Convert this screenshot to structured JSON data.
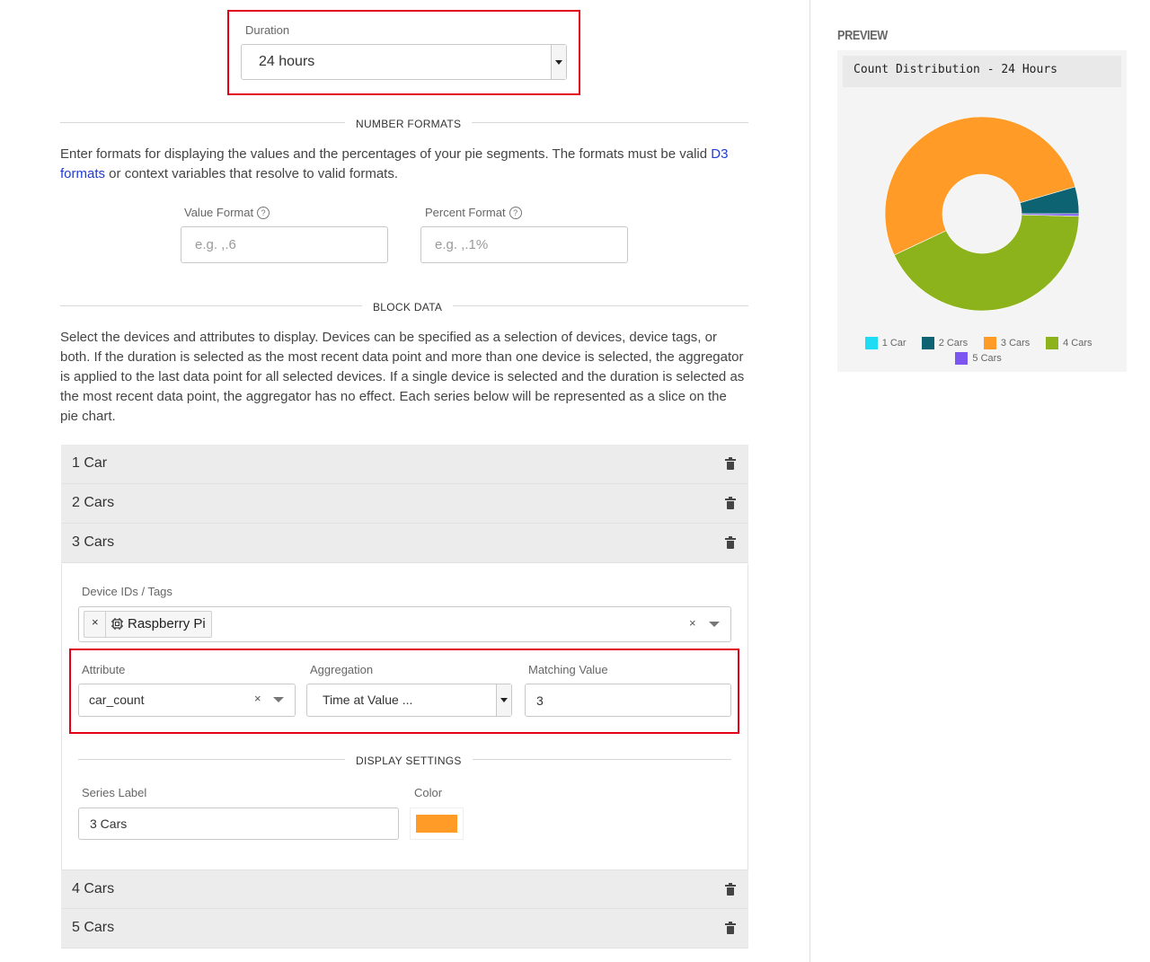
{
  "duration": {
    "label": "Duration",
    "value": "24 hours"
  },
  "number_formats": {
    "section_title": "NUMBER FORMATS",
    "desc_before_link": "Enter formats for displaying the values and the percentages of your pie segments. The formats must be valid ",
    "link_text": "D3 formats",
    "desc_after_link": " or context variables that resolve to valid formats.",
    "value_format": {
      "label": "Value Format",
      "placeholder": "e.g. ,.6"
    },
    "percent_format": {
      "label": "Percent Format",
      "placeholder": "e.g. ,.1%"
    },
    "help_glyph": "?"
  },
  "block_data": {
    "section_title": "BLOCK DATA",
    "description": "Select the devices and attributes to display. Devices can be specified as a selection of devices, device tags, or both. If the duration is selected as the most recent data point and more than one device is selected, the aggregator is applied to the last data point for all selected devices. If a single device is selected and the duration is selected as the most recent data point, the aggregator has no effect. Each series below will be represented as a slice on the pie chart."
  },
  "series": [
    {
      "label": "1 Car"
    },
    {
      "label": "2 Cars"
    },
    {
      "label": "3 Cars"
    },
    {
      "label": "4 Cars"
    },
    {
      "label": "5 Cars"
    }
  ],
  "expanded_series": {
    "device_label": "Device IDs / Tags",
    "device_chip": "Raspberry Pi",
    "attribute_label": "Attribute",
    "attribute_value": "car_count",
    "aggregation_label": "Aggregation",
    "aggregation_value": "Time at Value ...",
    "matching_label": "Matching Value",
    "matching_value": "3",
    "display_settings_title": "DISPLAY SETTINGS",
    "series_label_label": "Series Label",
    "series_label_value": "3 Cars",
    "color_label": "Color",
    "color_value": "#ff9b26",
    "clear_glyph": "×"
  },
  "preview": {
    "heading": "PREVIEW",
    "chart_title": "Count Distribution - 24 Hours"
  },
  "chart_data": {
    "type": "pie",
    "title": "Count Distribution - 24 Hours",
    "donut": true,
    "legend_position": "bottom",
    "categories": [
      "1 Car",
      "2 Cars",
      "3 Cars",
      "4 Cars",
      "5 Cars"
    ],
    "values": [
      0,
      4.5,
      52.5,
      42.6,
      0.4
    ],
    "colors": [
      "#1fdcf5",
      "#0e6372",
      "#ff9b26",
      "#8db31c",
      "#7c56f0"
    ]
  }
}
